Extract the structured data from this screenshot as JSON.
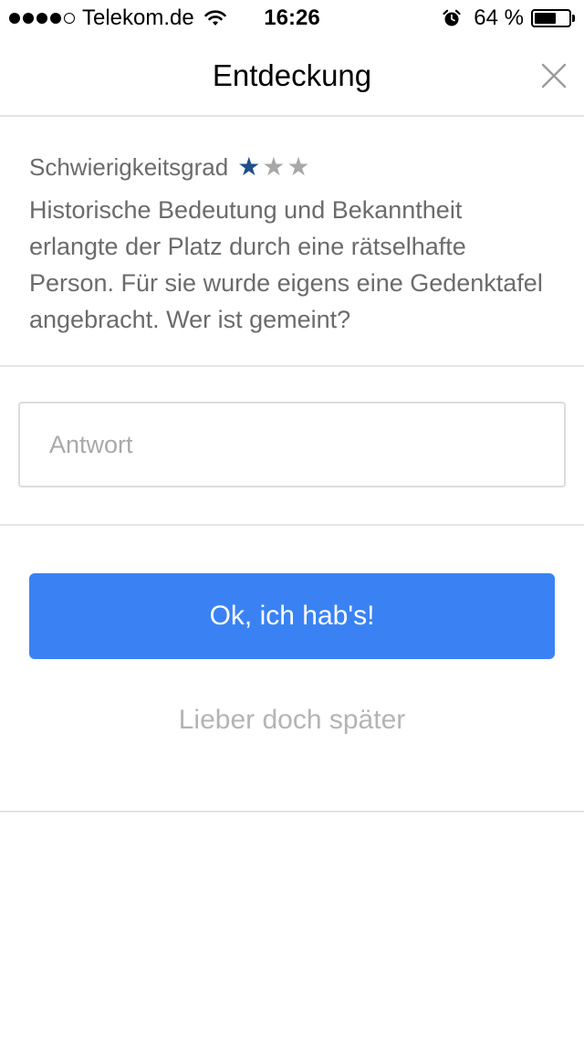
{
  "status_bar": {
    "carrier": "Telekom.de",
    "signal_bars_filled": 4,
    "signal_bars_total": 5,
    "time": "16:26",
    "battery_percent": "64 %",
    "battery_level": 0.64,
    "icons": [
      "wifi-icon",
      "alarm-icon",
      "battery-icon"
    ]
  },
  "nav": {
    "title": "Entdeckung",
    "close_icon": "close-icon"
  },
  "question": {
    "difficulty_label": "Schwierigkeitsgrad",
    "difficulty_rating": 1,
    "difficulty_max": 3,
    "text": "Historische Bedeutung und Bekanntheit erlangte der Platz durch eine rätselhafte Person. Für sie wurde eigens eine Gedenktafel angebracht. Wer ist gemeint?"
  },
  "answer": {
    "placeholder": "Antwort",
    "value": ""
  },
  "actions": {
    "submit_label": "Ok, ich hab's!",
    "later_label": "Lieber doch später"
  },
  "colors": {
    "primary_button": "#3a82f4",
    "star_filled": "#1d4f8c",
    "star_empty": "#a8a8a8",
    "secondary_text": "#6b6b6b",
    "muted_link": "#b4b4b4",
    "divider": "#e4e4e4"
  }
}
